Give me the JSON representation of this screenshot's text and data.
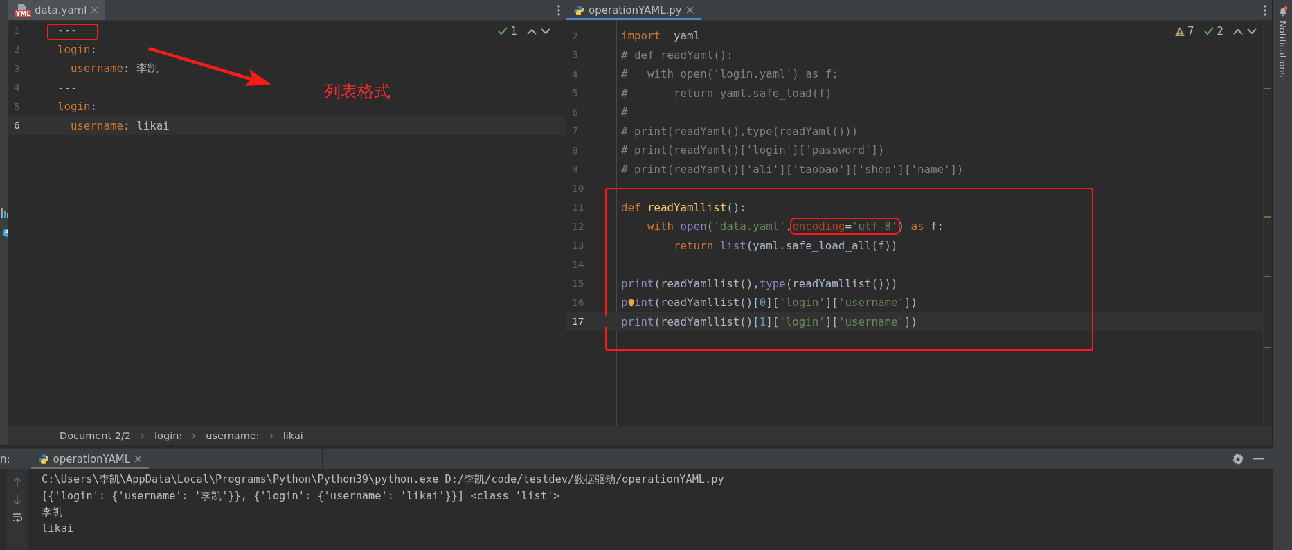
{
  "editors": [
    {
      "kind": "yaml",
      "tab": {
        "name": "data.yaml",
        "badge": "YML",
        "selected": false
      },
      "inspections": [
        {
          "kind": "ok",
          "count": "1"
        }
      ],
      "note": "列表格式",
      "lines": [
        {
          "n": "1",
          "current": false,
          "tokens": [
            {
              "kind": "plain",
              "t": "---"
            }
          ]
        },
        {
          "n": "2",
          "current": false,
          "tokens": [
            {
              "kind": "key",
              "t": "login"
            },
            {
              "kind": "plain",
              "t": ":"
            }
          ]
        },
        {
          "n": "3",
          "current": false,
          "tokens": [
            {
              "kind": "key",
              "t": "  username"
            },
            {
              "kind": "plain",
              "t": ": 李凯"
            }
          ]
        },
        {
          "n": "4",
          "current": false,
          "tokens": [
            {
              "kind": "plain",
              "t": "---"
            }
          ]
        },
        {
          "n": "5",
          "current": false,
          "tokens": [
            {
              "kind": "key",
              "t": "login"
            },
            {
              "kind": "plain",
              "t": ":"
            }
          ]
        },
        {
          "n": "6",
          "current": true,
          "tokens": [
            {
              "kind": "key",
              "t": "  username"
            },
            {
              "kind": "plain",
              "t": ": likai"
            }
          ]
        }
      ],
      "breadcrumbs": [
        "Document 2/2",
        "login:",
        "username:",
        "likai"
      ]
    },
    {
      "kind": "python",
      "tab": {
        "name": "operationYAML.py",
        "selected": true
      },
      "inspections": [
        {
          "kind": "warning",
          "count": "7"
        },
        {
          "kind": "ok",
          "count": "2"
        }
      ],
      "lines": [
        {
          "n": "2",
          "current": false,
          "tokens": [
            {
              "kind": "kw",
              "t": "import"
            },
            {
              "kind": "plain",
              "t": "  yaml"
            }
          ]
        },
        {
          "n": "3",
          "current": false,
          "tokens": [
            {
              "kind": "comment",
              "t": "# def readYaml():"
            }
          ]
        },
        {
          "n": "4",
          "current": false,
          "tokens": [
            {
              "kind": "comment",
              "t": "#   with open('login.yaml') as f:"
            }
          ]
        },
        {
          "n": "5",
          "current": false,
          "tokens": [
            {
              "kind": "comment",
              "t": "#       return yaml.safe_load(f)"
            }
          ]
        },
        {
          "n": "6",
          "current": false,
          "tokens": [
            {
              "kind": "comment",
              "t": "#"
            }
          ]
        },
        {
          "n": "7",
          "current": false,
          "tokens": [
            {
              "kind": "comment",
              "t": "# print(readYaml(),type(readYaml()))"
            }
          ]
        },
        {
          "n": "8",
          "current": false,
          "tokens": [
            {
              "kind": "comment",
              "t": "# print(readYaml()['login']['password'])"
            }
          ]
        },
        {
          "n": "9",
          "current": false,
          "tokens": [
            {
              "kind": "comment",
              "t": "# print(readYaml()['ali']['taobao']['shop']['name'])"
            }
          ]
        },
        {
          "n": "10",
          "current": false
        },
        {
          "n": "11",
          "current": false,
          "tokens": [
            {
              "kind": "kw",
              "t": "def"
            },
            {
              "kind": "fn",
              "t": " readYamllist"
            },
            {
              "kind": "plain",
              "t": "():"
            }
          ]
        },
        {
          "n": "12",
          "current": false,
          "tokens": [
            {
              "kind": "kw",
              "t": "    with"
            },
            {
              "kind": "builtin",
              "t": " open"
            },
            {
              "kind": "plain",
              "t": "("
            },
            {
              "kind": "str",
              "t": "'data.yaml'"
            },
            {
              "kind": "plain",
              "t": ","
            },
            {
              "kind": "boxed",
              "tokens": [
                {
                  "kind": "kwarg",
                  "t": "encoding"
                },
                {
                  "kind": "plain",
                  "t": "="
                },
                {
                  "kind": "str",
                  "t": "'utf-8'"
                }
              ]
            },
            {
              "kind": "plain",
              "t": ") "
            },
            {
              "kind": "kw",
              "t": "as"
            },
            {
              "kind": "plain",
              "t": " f:"
            }
          ]
        },
        {
          "n": "13",
          "current": false,
          "tokens": [
            {
              "kind": "kw",
              "t": "        return"
            },
            {
              "kind": "builtin",
              "t": " list"
            },
            {
              "kind": "plain",
              "t": "(yaml.safe_load_all(f))"
            }
          ]
        },
        {
          "n": "14",
          "current": false
        },
        {
          "n": "15",
          "current": false,
          "tokens": [
            {
              "kind": "builtin",
              "t": "print"
            },
            {
              "kind": "plain",
              "t": "(readYamllist(),"
            },
            {
              "kind": "builtin",
              "t": "type"
            },
            {
              "kind": "plain",
              "t": "(readYamllist()))"
            }
          ]
        },
        {
          "n": "16",
          "current": false,
          "tokens": [
            {
              "kind": "builtin",
              "t": "p"
            },
            {
              "kind": "bulb"
            },
            {
              "kind": "builtin",
              "t": "int"
            },
            {
              "kind": "plain",
              "t": "(readYamllist()["
            },
            {
              "kind": "num",
              "t": "0"
            },
            {
              "kind": "plain",
              "t": "]["
            },
            {
              "kind": "str",
              "t": "'login'"
            },
            {
              "kind": "plain",
              "t": "]["
            },
            {
              "kind": "str",
              "t": "'username'"
            },
            {
              "kind": "plain",
              "t": "])"
            }
          ]
        },
        {
          "n": "17",
          "current": true,
          "tokens": [
            {
              "kind": "builtin",
              "t": "print"
            },
            {
              "kind": "plain",
              "t": "(readYamllist()["
            },
            {
              "kind": "num",
              "t": "1"
            },
            {
              "kind": "plain",
              "t": "]["
            },
            {
              "kind": "str",
              "t": "'login'"
            },
            {
              "kind": "plain",
              "t": "]["
            },
            {
              "kind": "str",
              "t": "'username'"
            },
            {
              "kind": "plain",
              "t": "])"
            }
          ]
        }
      ]
    }
  ],
  "run": {
    "prefix": "n:",
    "tab": {
      "name": "operationYAML",
      "selected": true
    },
    "output": [
      "C:\\Users\\李凯\\AppData\\Local\\Programs\\Python\\Python39\\python.exe D:/李凯/code/testdev/数据驱动/operationYAML.py",
      "[{'login': {'username': '李凯'}}, {'login': {'username': 'likai'}}] <class 'list'>",
      "李凯",
      "likai"
    ]
  },
  "notifications": {
    "label": "Notifications"
  }
}
